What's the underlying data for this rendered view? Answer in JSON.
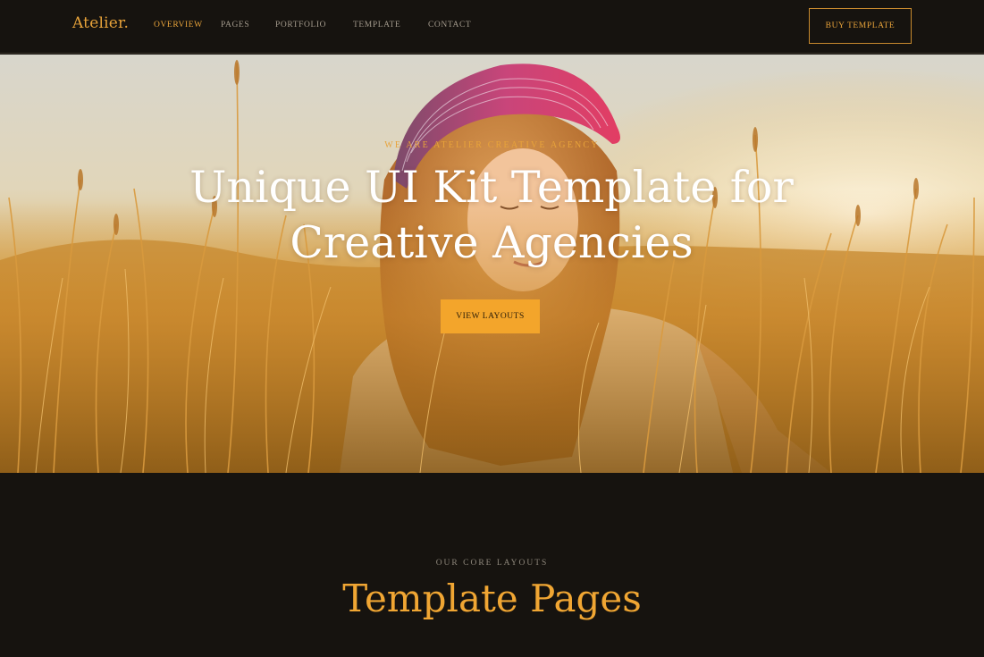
{
  "header": {
    "logo": "Atelier.",
    "nav": [
      {
        "label": "OVERVIEW",
        "active": true
      },
      {
        "label": "PAGES",
        "active": false
      },
      {
        "label": "PORTFOLIO",
        "active": false
      },
      {
        "label": "TEMPLATE",
        "active": false
      },
      {
        "label": "CONTACT",
        "active": false
      }
    ],
    "cta_label": "BUY TEMPLATE"
  },
  "hero": {
    "eyebrow": "WE ARE ATELIER CREATIVE AGENCY",
    "title": "Unique UI Kit Template for Creative Agencies",
    "button_label": "VIEW LAYOUTS",
    "image": "woman-in-wheat-field-photo"
  },
  "section": {
    "eyebrow": "OUR CORE LAYOUTS",
    "title": "Template Pages"
  },
  "colors": {
    "accent": "#f3a52b",
    "background": "#16130f",
    "nav_text": "#a39a8c"
  }
}
